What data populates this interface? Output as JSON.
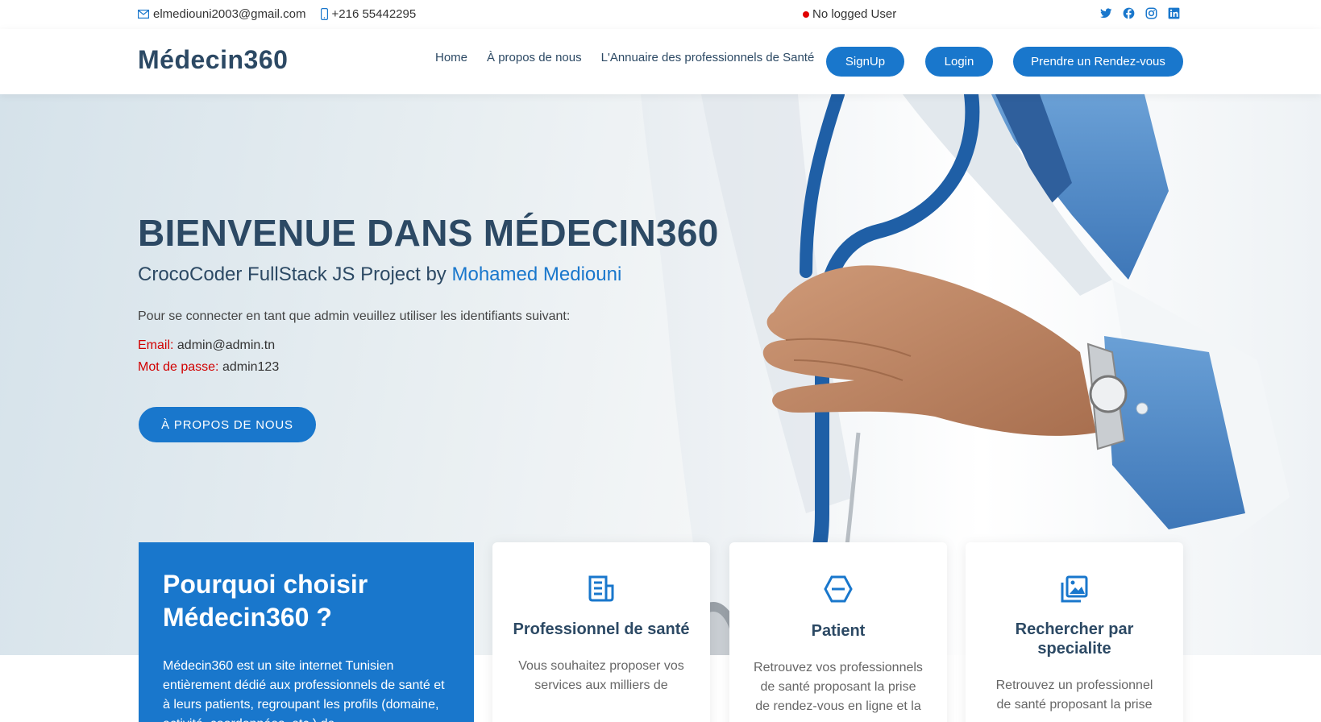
{
  "topbar": {
    "email": "elmediouni2003@gmail.com",
    "phone": "+216 55442295",
    "user_status": "No logged User",
    "socials": [
      "twitter-icon",
      "facebook-icon",
      "instagram-icon",
      "linkedin-icon"
    ]
  },
  "header": {
    "logo": "Médecin360",
    "nav": [
      "Home",
      "À propos de nous",
      "L'Annuaire des professionnels de Santé"
    ],
    "signup": "SignUp",
    "login": "Login",
    "appointment": "Prendre un Rendez-vous"
  },
  "hero": {
    "title": "BIENVENUE DANS MÉDECIN360",
    "subtitle_prefix": "CrocoCoder FullStack JS Project by",
    "author": "Mohamed Mediouni",
    "note": "Pour se connecter en tant que admin veuillez utiliser les identifiants suivant:",
    "email_label": "Email:",
    "email_value": "admin@admin.tn",
    "password_label": "Mot de passe:",
    "password_value": "admin123",
    "button": "À PROPOS DE NOUS"
  },
  "why": {
    "title": "Pourquoi choisir Médecin360 ?",
    "text": "Médecin360 est un site internet Tunisien entièrement dédié aux professionnels de santé et à leurs patients, regroupant les profils (domaine, activité, coordonnées, etc.) de"
  },
  "cards": [
    {
      "title": "Professionnel de santé",
      "text": "Vous souhaitez proposer vos services aux milliers de"
    },
    {
      "title": "Patient",
      "text": "Retrouvez vos professionnels de santé proposant la prise de rendez-vous en ligne et la"
    },
    {
      "title": "Rechercher par specialite",
      "text": "Retrouvez un professionnel de santé proposant la prise"
    }
  ],
  "colors": {
    "primary": "#1977cc",
    "dark": "#2c4964",
    "red": "#d10000"
  }
}
